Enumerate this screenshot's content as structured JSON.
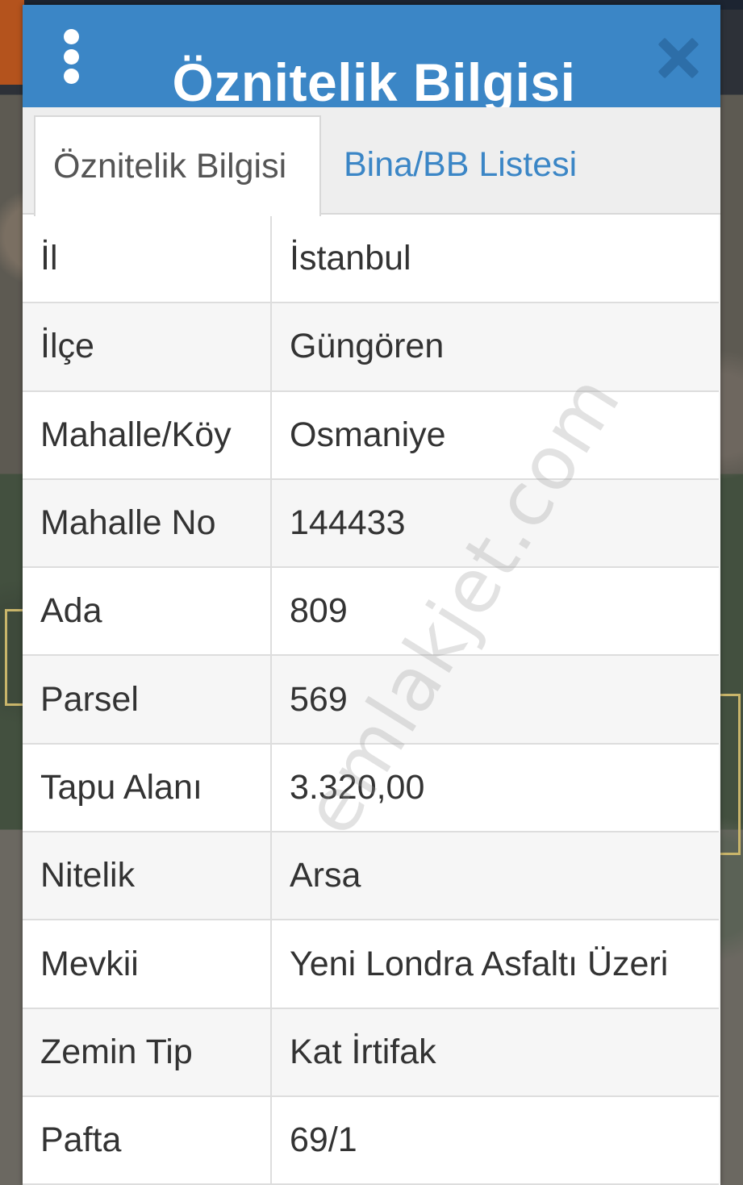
{
  "panel": {
    "title": "Öznitelik Bilgisi"
  },
  "tabs": [
    {
      "label": "Öznitelik Bilgisi",
      "active": true
    },
    {
      "label": "Bina/BB Listesi",
      "active": false
    }
  ],
  "attributes": [
    {
      "key": "İl",
      "value": "İstanbul"
    },
    {
      "key": "İlçe",
      "value": "Güngören"
    },
    {
      "key": "Mahalle/Köy",
      "value": "Osmaniye"
    },
    {
      "key": "Mahalle No",
      "value": "144433"
    },
    {
      "key": "Ada",
      "value": "809"
    },
    {
      "key": "Parsel",
      "value": "569"
    },
    {
      "key": "Tapu Alanı",
      "value": "3.320,00"
    },
    {
      "key": "Nitelik",
      "value": "Arsa"
    },
    {
      "key": "Mevkii",
      "value": "Yeni Londra Asfaltı Üzeri"
    },
    {
      "key": "Zemin Tip",
      "value": "Kat İrtifak"
    },
    {
      "key": "Pafta",
      "value": "69/1"
    }
  ],
  "watermark": "emlakjet.com",
  "colors": {
    "header": "#3b86c6",
    "tab_link": "#3b86c6",
    "close_icon": "#2d6ea8"
  },
  "icons": {
    "menu": "more-vertical-icon",
    "close": "close-icon"
  }
}
